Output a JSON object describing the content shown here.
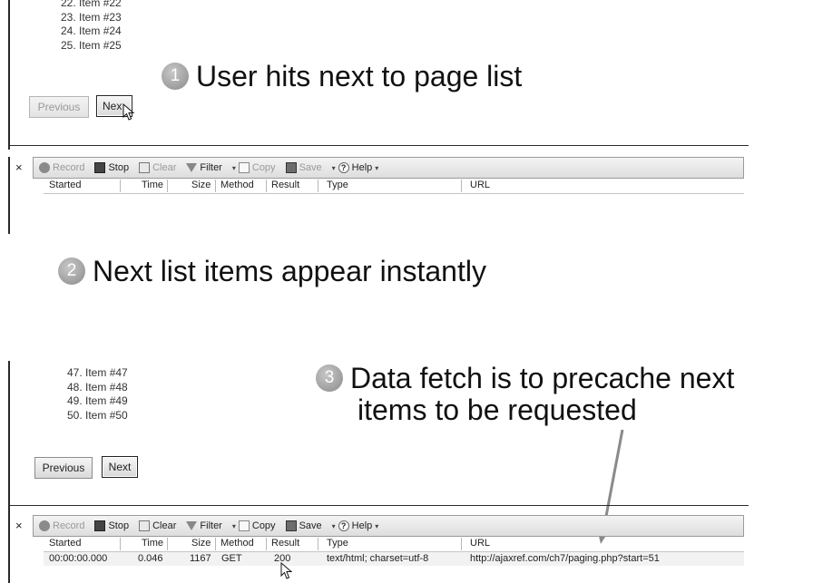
{
  "list_top": [
    "22. Item #22",
    "23. Item #23",
    "24. Item #24",
    "25. Item #25"
  ],
  "list_bottom": [
    "47. Item #47",
    "48. Item #48",
    "49. Item #49",
    "50. Item #50"
  ],
  "buttons": {
    "previous": "Previous",
    "next_partial": "Nex",
    "next": "Next"
  },
  "callouts": {
    "one": {
      "num": "1",
      "text": "User hits next to page list"
    },
    "two": {
      "num": "2",
      "text": "Next list items appear instantly"
    },
    "three": {
      "num": "3",
      "line1": "Data fetch is to precache next",
      "line2": "items to be requested"
    }
  },
  "toolbar": {
    "close": "×",
    "record": "Record",
    "stop": "Stop",
    "clear": "Clear",
    "filter": "Filter",
    "copy": "Copy",
    "save": "Save",
    "help": "Help",
    "help_glyph": "?",
    "dropdown": "▾"
  },
  "columns": [
    "Started",
    "Time",
    "Size",
    "Method",
    "Result",
    "Type",
    "URL"
  ],
  "request_row": {
    "started": "00:00:00.000",
    "time": "0.046",
    "size": "1167",
    "method": "GET",
    "result": "200",
    "type": "text/html; charset=utf-8",
    "url": "http://ajaxref.com/ch7/paging.php?start=51"
  }
}
